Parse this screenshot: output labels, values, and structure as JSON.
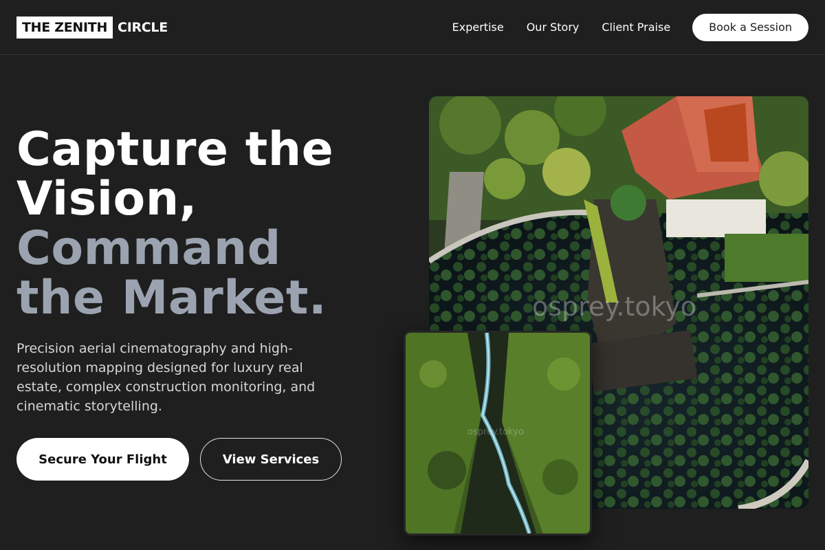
{
  "brand": {
    "box_text": "THE ZENITH",
    "rest_text": "CIRCLE"
  },
  "nav": {
    "links": [
      "Expertise",
      "Our Story",
      "Client Praise"
    ],
    "cta": "Book a Session"
  },
  "hero": {
    "title_lines": [
      "Capture the",
      "Vision,"
    ],
    "title_muted_lines": [
      "Command",
      "the Market."
    ],
    "subtitle": "Precision aerial cinematography and high-resolution mapping designed for luxury real estate, complex construction monitoring, and cinematic storytelling.",
    "primary_button": "Secure Your Flight",
    "secondary_button": "View Services"
  },
  "images": {
    "main_watermark": "osprey.tokyo",
    "small_watermark": "osprey.tokyo"
  },
  "colors": {
    "background": "#1f1f1f",
    "muted_title": "#9ba3b0",
    "button_fill": "#ffffff"
  }
}
